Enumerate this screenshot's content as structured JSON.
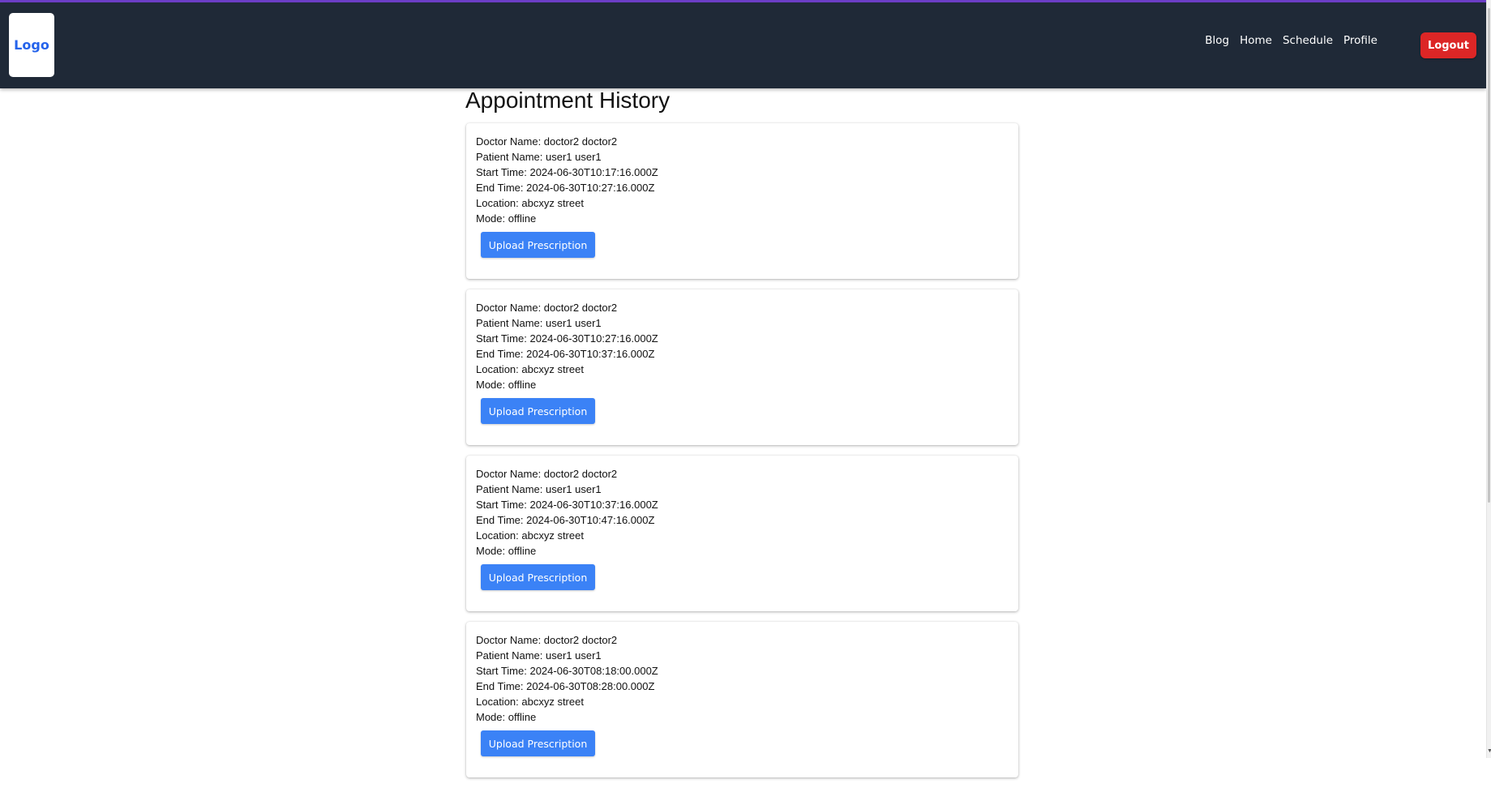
{
  "nav": {
    "logo": "Logo",
    "links": [
      "Blog",
      "Home",
      "Schedule",
      "Profile"
    ],
    "logout_label": "Logout"
  },
  "main": {
    "title": "Appointment History",
    "appointments": [
      {
        "doctor": "Doctor Name: doctor2 doctor2",
        "patient": "Patient Name: user1 user1",
        "start": "Start Time: 2024-06-30T10:17:16.000Z",
        "end": "End Time: 2024-06-30T10:27:16.000Z",
        "location": "Location: abcxyz street",
        "mode": "Mode: offline",
        "button": "Upload Prescription"
      },
      {
        "doctor": "Doctor Name: doctor2 doctor2",
        "patient": "Patient Name: user1 user1",
        "start": "Start Time: 2024-06-30T10:27:16.000Z",
        "end": "End Time: 2024-06-30T10:37:16.000Z",
        "location": "Location: abcxyz street",
        "mode": "Mode: offline",
        "button": "Upload Prescription"
      },
      {
        "doctor": "Doctor Name: doctor2 doctor2",
        "patient": "Patient Name: user1 user1",
        "start": "Start Time: 2024-06-30T10:37:16.000Z",
        "end": "End Time: 2024-06-30T10:47:16.000Z",
        "location": "Location: abcxyz street",
        "mode": "Mode: offline",
        "button": "Upload Prescription"
      },
      {
        "doctor": "Doctor Name: doctor2 doctor2",
        "patient": "Patient Name: user1 user1",
        "start": "Start Time: 2024-06-30T08:18:00.000Z",
        "end": "End Time: 2024-06-30T08:28:00.000Z",
        "location": "Location: abcxyz street",
        "mode": "Mode: offline",
        "button": "Upload Prescription"
      }
    ]
  },
  "colors": {
    "navbar": "#1f2937",
    "accent": "#6d3fc9",
    "logout": "#dc2626",
    "primary_button": "#3b82f6",
    "logo_text": "#2563eb"
  }
}
